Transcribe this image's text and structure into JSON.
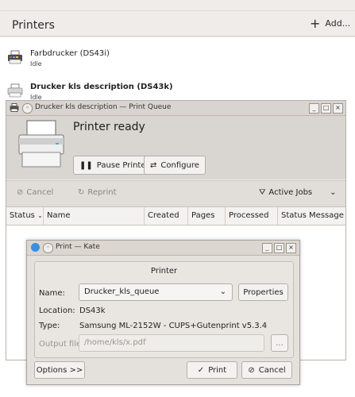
{
  "settings": {
    "title": "Printers",
    "add_label": "Add...",
    "printers": [
      {
        "name": "Farbdrucker (DS43i)",
        "state": "Idle"
      },
      {
        "name": "Drucker kls description (DS43k)",
        "state": "Idle"
      }
    ]
  },
  "queue_window": {
    "title": "Drucker kls description — Print Queue",
    "status": "Printer ready",
    "pause_label": "Pause Printer",
    "configure_label": "Configure",
    "cancel_label": "Cancel",
    "reprint_label": "Reprint",
    "filter_label": "Active Jobs",
    "columns": [
      "Status",
      "Name",
      "Created",
      "Pages",
      "Processed",
      "Status Message"
    ]
  },
  "print_dialog": {
    "title": "Print — Kate",
    "group_title": "Printer",
    "name_label": "Name:",
    "name_value": "Drucker_kls_queue",
    "properties_label": "Properties",
    "location_label": "Location:",
    "location_value": "DS43k",
    "type_label": "Type:",
    "type_value": "Samsung ML-2152W - CUPS+Gutenprint v5.3.4",
    "output_label": "Output file:",
    "output_value": "/home/kls/x.pdf",
    "browse_label": "...",
    "options_label": "Options >>",
    "print_label": "Print",
    "cancel_label": "Cancel"
  }
}
